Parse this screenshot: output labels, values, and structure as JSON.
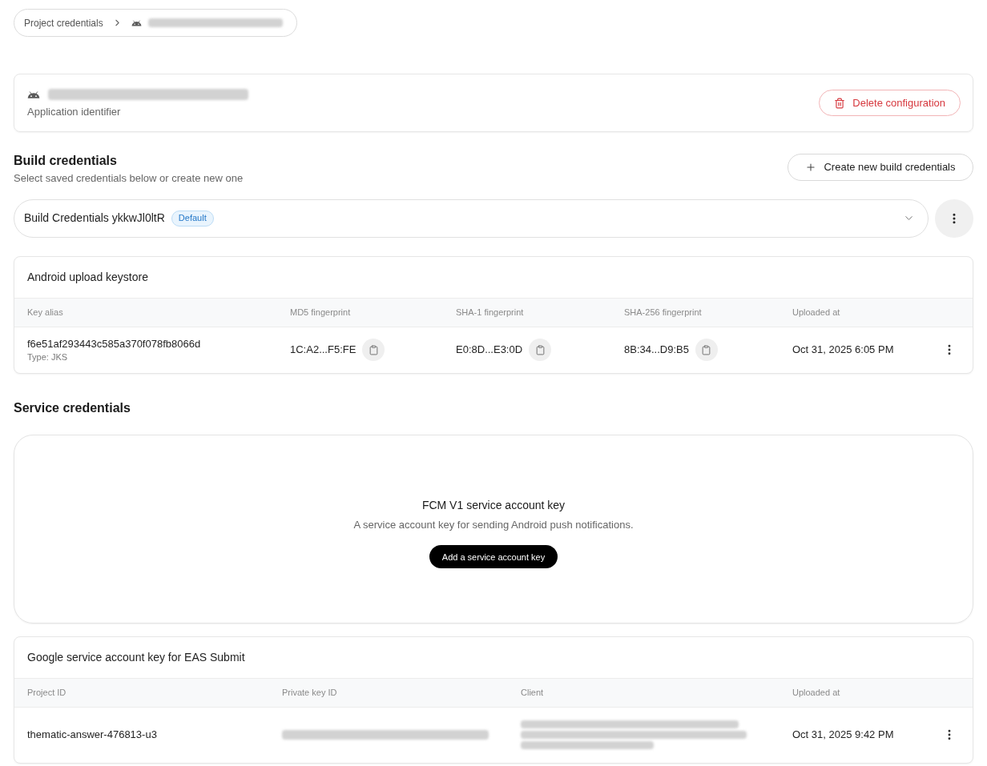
{
  "breadcrumb": {
    "items": [
      {
        "kind": "link",
        "label": "Project credentials"
      },
      {
        "kind": "redacted_app"
      }
    ]
  },
  "application": {
    "identifier": {
      "kind": "redacted"
    },
    "caption": "Application identifier",
    "delete_button": "Delete configuration"
  },
  "build_credentials": {
    "title": "Build credentials",
    "subtitle": "Select saved credentials below or create new one",
    "create_button": "Create new build credentials",
    "select": {
      "value": "Build Credentials ykkwJl0ltR",
      "badge": "Default"
    }
  },
  "keystore": {
    "title": "Android upload keystore",
    "columns": [
      "Key alias",
      "MD5 fingerprint",
      "SHA-1 fingerprint",
      "SHA-256 fingerprint",
      "Uploaded at"
    ],
    "rows": [
      {
        "cells": [
          {
            "kind": "alias",
            "text": "f6e51af293443c585a370f078fb8066d",
            "sub": "Type: JKS"
          },
          {
            "kind": "copy",
            "text": "1C:A2...F5:FE"
          },
          {
            "kind": "copy",
            "text": "E0:8D...E3:0D"
          },
          {
            "kind": "copy",
            "text": "8B:34...D9:B5"
          },
          {
            "kind": "text",
            "text": "Oct 31, 2025 6:05 PM"
          }
        ]
      }
    ]
  },
  "service_credentials": {
    "title": "Service credentials"
  },
  "fcm": {
    "title": "FCM V1 service account key",
    "description": "A service account key for sending Android push notifications.",
    "button": "Add a service account key"
  },
  "google_key": {
    "title": "Google service account key for EAS Submit",
    "columns": [
      "Project ID",
      "Private key ID",
      "Client",
      "Uploaded at"
    ],
    "rows": [
      {
        "cells": [
          {
            "kind": "text",
            "text": "thematic-answer-476813-u3"
          },
          {
            "kind": "redacted"
          },
          {
            "kind": "redacted_block"
          },
          {
            "kind": "text",
            "text": "Oct 31, 2025 9:42 PM"
          }
        ]
      }
    ]
  }
}
